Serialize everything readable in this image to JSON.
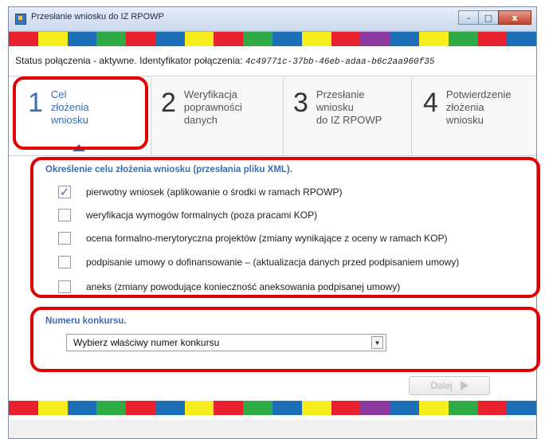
{
  "window": {
    "title": "Przesłanie wniosku do IZ RPOWP",
    "minimize_glyph": "–",
    "maximize_glyph": "□",
    "close_glyph": "x"
  },
  "colorbar_colors": [
    "#e8212e",
    "#f7ec1d",
    "#1d6fb8",
    "#2eab45",
    "#e8212e",
    "#1d6fb8",
    "#f7ec1d",
    "#e8212e",
    "#2eab45",
    "#1d6fb8",
    "#f7ec1d",
    "#e8212e",
    "#8c3aa0",
    "#1d6fb8",
    "#f7ec1d",
    "#2eab45",
    "#e8212e",
    "#1d6fb8"
  ],
  "status": {
    "prefix": "Status połączenia - aktywne. Identyfikator połączenia: ",
    "connection_id": "4c49771c-37bb-46eb-adaa-b6c2aa960f35"
  },
  "steps": [
    {
      "number": "1",
      "label": "Cel\nzłożenia\nwniosku"
    },
    {
      "number": "2",
      "label": "Weryfikacja\npoprawności\ndanych"
    },
    {
      "number": "3",
      "label": "Przesłanie\nwniosku\ndo IZ RPOWP"
    },
    {
      "number": "4",
      "label": "Potwierdzenie\nzłożenia\nwniosku"
    }
  ],
  "purpose": {
    "title": "Określenie celu złożenia wniosku (przesłania pliku XML).",
    "options": [
      {
        "label": "pierwotny wniosek (aplikowanie o środki w ramach RPOWP)",
        "checked": true,
        "check_glyph": "✓"
      },
      {
        "label": "weryfikacja wymogów formalnych (poza pracami KOP)",
        "checked": false
      },
      {
        "label": "ocena formalno-merytoryczna projektów (zmiany wynikające z oceny w ramach KOP)",
        "checked": false
      },
      {
        "label": "podpisanie umowy o dofinansowanie – (aktualizacja danych przed podpisaniem umowy)",
        "checked": false
      },
      {
        "label": "aneks (zmiany powodujące konieczność aneksowania podpisanej umowy)",
        "checked": false
      }
    ]
  },
  "contest": {
    "title": "Numeru konkursu.",
    "select_value": "Wybierz właściwy numer konkursu",
    "arrow_glyph": "▼"
  },
  "next_button": {
    "label": "Dalej"
  },
  "colors": {
    "accent": "#3b6db4",
    "highlight": "#e00000"
  }
}
